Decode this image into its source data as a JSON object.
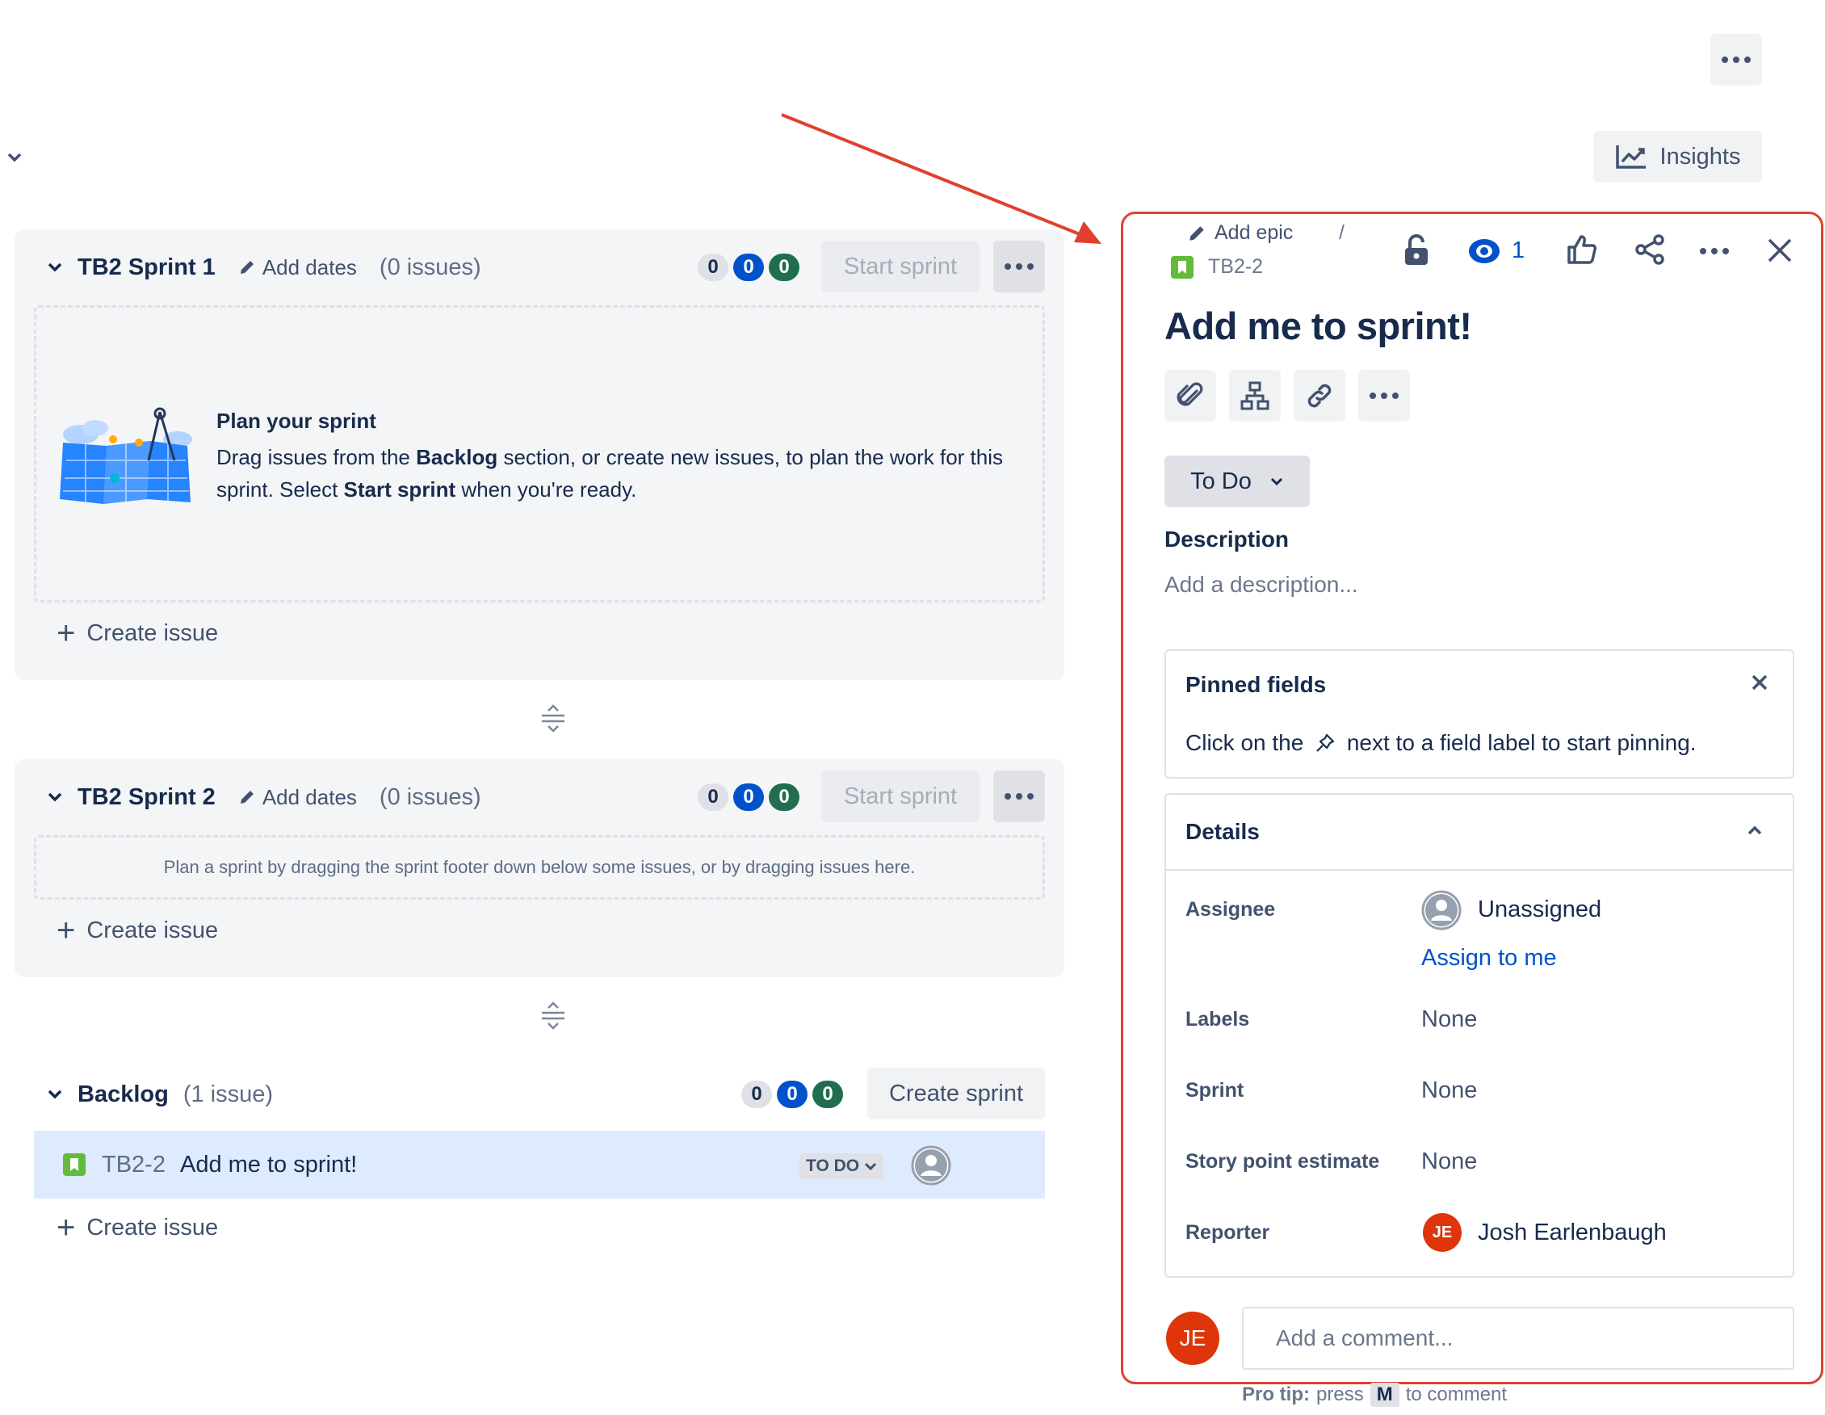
{
  "top": {
    "insights_label": "Insights"
  },
  "sprint1": {
    "name": "TB2 Sprint 1",
    "add_dates": "Add dates",
    "issue_count": "(0 issues)",
    "counts": [
      "0",
      "0",
      "0"
    ],
    "start_label": "Start sprint",
    "plan_title": "Plan your sprint",
    "plan_text_1": "Drag issues from the ",
    "plan_bold_1": "Backlog",
    "plan_text_2": " section, or create new issues, to plan the work for this",
    "plan_text_3": "sprint. Select ",
    "plan_bold_2": "Start sprint",
    "plan_text_4": " when you're ready.",
    "create_issue": "Create issue"
  },
  "sprint2": {
    "name": "TB2 Sprint 2",
    "add_dates": "Add dates",
    "issue_count": "(0 issues)",
    "counts": [
      "0",
      "0",
      "0"
    ],
    "start_label": "Start sprint",
    "hint": "Plan a sprint by dragging the sprint footer down below some issues, or by dragging issues here.",
    "create_issue": "Create issue"
  },
  "backlog": {
    "name": "Backlog",
    "issue_count": "(1 issue)",
    "counts": [
      "0",
      "0",
      "0"
    ],
    "create_sprint": "Create sprint",
    "issue": {
      "key": "TB2-2",
      "summary": "Add me to sprint!",
      "status": "TO DO"
    },
    "create_issue": "Create issue"
  },
  "panel": {
    "add_epic": "Add epic",
    "separator": "/",
    "issue_key": "TB2-2",
    "watch_count": "1",
    "title": "Add me to sprint!",
    "status": "To Do",
    "description_label": "Description",
    "description_placeholder": "Add a description...",
    "pinned": {
      "title": "Pinned fields",
      "text_before": "Click on the ",
      "text_after": " next to a field label to start pinning."
    },
    "details": {
      "title": "Details",
      "assignee_label": "Assignee",
      "assignee_value": "Unassigned",
      "assign_to_me": "Assign to me",
      "labels_label": "Labels",
      "labels_value": "None",
      "sprint_label": "Sprint",
      "sprint_value": "None",
      "story_label": "Story point estimate",
      "story_value": "None",
      "reporter_label": "Reporter",
      "reporter_initials": "JE",
      "reporter_value": "Josh Earlenbaugh"
    },
    "comment": {
      "avatar_initials": "JE",
      "placeholder": "Add a comment...",
      "pro_tip_bold": "Pro tip:",
      "pro_tip_text_1": "press",
      "pro_tip_key": "M",
      "pro_tip_text_2": "to comment"
    }
  },
  "colors": {
    "annotation_red": "#e0412f",
    "link_blue": "#0052cc",
    "story_green": "#36b37e",
    "avatar_red": "#de350b"
  }
}
